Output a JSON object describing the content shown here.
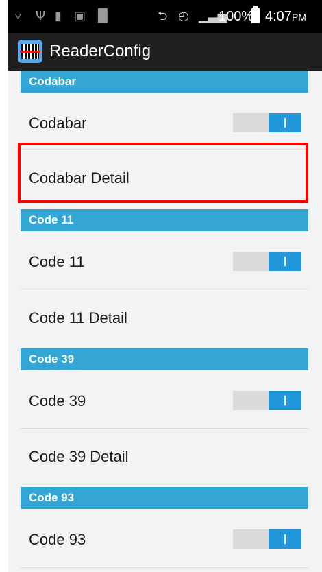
{
  "status_bar": {
    "icons": [
      "wifi-icon",
      "usb-icon",
      "sim-icon",
      "screenshot-icon",
      "barcode-icon",
      "bluetooth-icon",
      "alarm-icon",
      "signal-icon",
      "battery-icon"
    ],
    "battery_text": "100%",
    "time": "4:07",
    "time_suffix": "PM"
  },
  "app_bar": {
    "title": "ReaderConfig",
    "icon": "barcode-scanner-icon"
  },
  "sections": {
    "codabar": {
      "header": "Codabar",
      "toggle_label": "Codabar",
      "toggle_on": true,
      "detail_label": "Codabar Detail"
    },
    "code11": {
      "header": "Code 11",
      "toggle_label": "Code 11",
      "toggle_on": true,
      "detail_label": "Code 11 Detail"
    },
    "code39": {
      "header": "Code 39",
      "toggle_label": "Code 39",
      "toggle_on": true,
      "detail_label": "Code 39 Detail"
    },
    "code93": {
      "header": "Code 93",
      "toggle_label": "Code 93",
      "toggle_on": true
    }
  },
  "colors": {
    "section_header": "#33a6d6",
    "toggle_on": "#2196d8",
    "highlight": "#ff0000",
    "app_bar": "#1f1f1f",
    "background": "#f3f3f3"
  }
}
